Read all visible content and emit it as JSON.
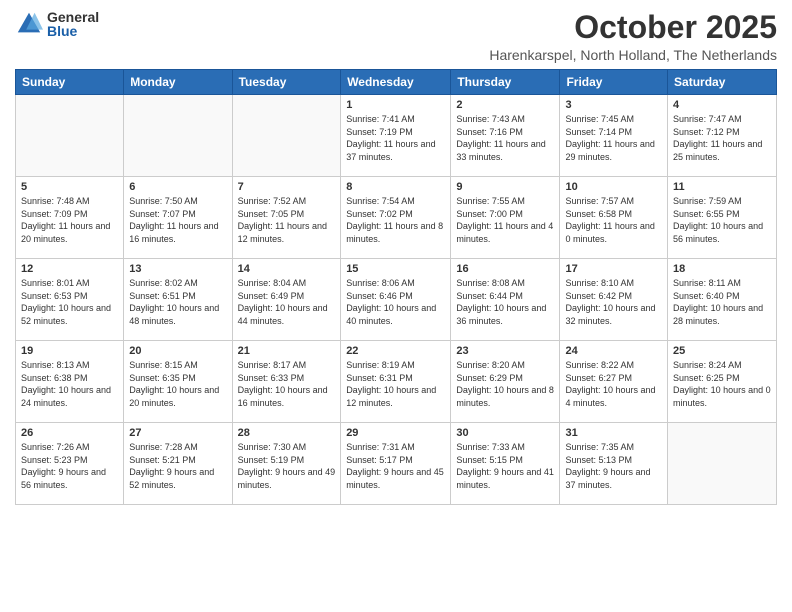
{
  "logo": {
    "general": "General",
    "blue": "Blue"
  },
  "title": "October 2025",
  "location": "Harenkarspel, North Holland, The Netherlands",
  "weekdays": [
    "Sunday",
    "Monday",
    "Tuesday",
    "Wednesday",
    "Thursday",
    "Friday",
    "Saturday"
  ],
  "weeks": [
    [
      {
        "day": "",
        "content": ""
      },
      {
        "day": "",
        "content": ""
      },
      {
        "day": "",
        "content": ""
      },
      {
        "day": "1",
        "content": "Sunrise: 7:41 AM\nSunset: 7:19 PM\nDaylight: 11 hours\nand 37 minutes."
      },
      {
        "day": "2",
        "content": "Sunrise: 7:43 AM\nSunset: 7:16 PM\nDaylight: 11 hours\nand 33 minutes."
      },
      {
        "day": "3",
        "content": "Sunrise: 7:45 AM\nSunset: 7:14 PM\nDaylight: 11 hours\nand 29 minutes."
      },
      {
        "day": "4",
        "content": "Sunrise: 7:47 AM\nSunset: 7:12 PM\nDaylight: 11 hours\nand 25 minutes."
      }
    ],
    [
      {
        "day": "5",
        "content": "Sunrise: 7:48 AM\nSunset: 7:09 PM\nDaylight: 11 hours\nand 20 minutes."
      },
      {
        "day": "6",
        "content": "Sunrise: 7:50 AM\nSunset: 7:07 PM\nDaylight: 11 hours\nand 16 minutes."
      },
      {
        "day": "7",
        "content": "Sunrise: 7:52 AM\nSunset: 7:05 PM\nDaylight: 11 hours\nand 12 minutes."
      },
      {
        "day": "8",
        "content": "Sunrise: 7:54 AM\nSunset: 7:02 PM\nDaylight: 11 hours\nand 8 minutes."
      },
      {
        "day": "9",
        "content": "Sunrise: 7:55 AM\nSunset: 7:00 PM\nDaylight: 11 hours\nand 4 minutes."
      },
      {
        "day": "10",
        "content": "Sunrise: 7:57 AM\nSunset: 6:58 PM\nDaylight: 11 hours\nand 0 minutes."
      },
      {
        "day": "11",
        "content": "Sunrise: 7:59 AM\nSunset: 6:55 PM\nDaylight: 10 hours\nand 56 minutes."
      }
    ],
    [
      {
        "day": "12",
        "content": "Sunrise: 8:01 AM\nSunset: 6:53 PM\nDaylight: 10 hours\nand 52 minutes."
      },
      {
        "day": "13",
        "content": "Sunrise: 8:02 AM\nSunset: 6:51 PM\nDaylight: 10 hours\nand 48 minutes."
      },
      {
        "day": "14",
        "content": "Sunrise: 8:04 AM\nSunset: 6:49 PM\nDaylight: 10 hours\nand 44 minutes."
      },
      {
        "day": "15",
        "content": "Sunrise: 8:06 AM\nSunset: 6:46 PM\nDaylight: 10 hours\nand 40 minutes."
      },
      {
        "day": "16",
        "content": "Sunrise: 8:08 AM\nSunset: 6:44 PM\nDaylight: 10 hours\nand 36 minutes."
      },
      {
        "day": "17",
        "content": "Sunrise: 8:10 AM\nSunset: 6:42 PM\nDaylight: 10 hours\nand 32 minutes."
      },
      {
        "day": "18",
        "content": "Sunrise: 8:11 AM\nSunset: 6:40 PM\nDaylight: 10 hours\nand 28 minutes."
      }
    ],
    [
      {
        "day": "19",
        "content": "Sunrise: 8:13 AM\nSunset: 6:38 PM\nDaylight: 10 hours\nand 24 minutes."
      },
      {
        "day": "20",
        "content": "Sunrise: 8:15 AM\nSunset: 6:35 PM\nDaylight: 10 hours\nand 20 minutes."
      },
      {
        "day": "21",
        "content": "Sunrise: 8:17 AM\nSunset: 6:33 PM\nDaylight: 10 hours\nand 16 minutes."
      },
      {
        "day": "22",
        "content": "Sunrise: 8:19 AM\nSunset: 6:31 PM\nDaylight: 10 hours\nand 12 minutes."
      },
      {
        "day": "23",
        "content": "Sunrise: 8:20 AM\nSunset: 6:29 PM\nDaylight: 10 hours\nand 8 minutes."
      },
      {
        "day": "24",
        "content": "Sunrise: 8:22 AM\nSunset: 6:27 PM\nDaylight: 10 hours\nand 4 minutes."
      },
      {
        "day": "25",
        "content": "Sunrise: 8:24 AM\nSunset: 6:25 PM\nDaylight: 10 hours\nand 0 minutes."
      }
    ],
    [
      {
        "day": "26",
        "content": "Sunrise: 7:26 AM\nSunset: 5:23 PM\nDaylight: 9 hours\nand 56 minutes."
      },
      {
        "day": "27",
        "content": "Sunrise: 7:28 AM\nSunset: 5:21 PM\nDaylight: 9 hours\nand 52 minutes."
      },
      {
        "day": "28",
        "content": "Sunrise: 7:30 AM\nSunset: 5:19 PM\nDaylight: 9 hours\nand 49 minutes."
      },
      {
        "day": "29",
        "content": "Sunrise: 7:31 AM\nSunset: 5:17 PM\nDaylight: 9 hours\nand 45 minutes."
      },
      {
        "day": "30",
        "content": "Sunrise: 7:33 AM\nSunset: 5:15 PM\nDaylight: 9 hours\nand 41 minutes."
      },
      {
        "day": "31",
        "content": "Sunrise: 7:35 AM\nSunset: 5:13 PM\nDaylight: 9 hours\nand 37 minutes."
      },
      {
        "day": "",
        "content": ""
      }
    ]
  ]
}
